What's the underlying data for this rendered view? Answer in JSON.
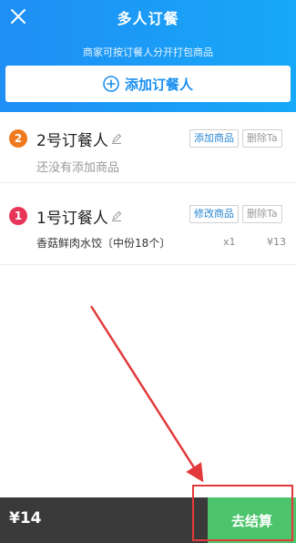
{
  "header": {
    "title": "多人订餐",
    "subtitle": "商家可按订餐人分开打包商品",
    "add_orderer_label": "添加订餐人",
    "colors": {
      "accent": "#1f8ef5",
      "accent_text": "#1a8ff0"
    }
  },
  "orderers": [
    {
      "badge": "2",
      "name": "2号订餐人",
      "primary_action": "添加商品",
      "delete_action": "删除Ta",
      "empty_text": "还没有添加商品",
      "badge_color": "#f07a1d"
    },
    {
      "badge": "1",
      "name": "1号订餐人",
      "primary_action": "修改商品",
      "delete_action": "删除Ta",
      "items": [
        {
          "name": "香菇鲜肉水饺〔中份18个〕",
          "qty": "x1",
          "price": "¥13"
        }
      ],
      "badge_color": "#e8365b"
    }
  ],
  "footer": {
    "total": "¥14",
    "checkout_label": "去结算",
    "checkout_color": "#4cc46b"
  }
}
